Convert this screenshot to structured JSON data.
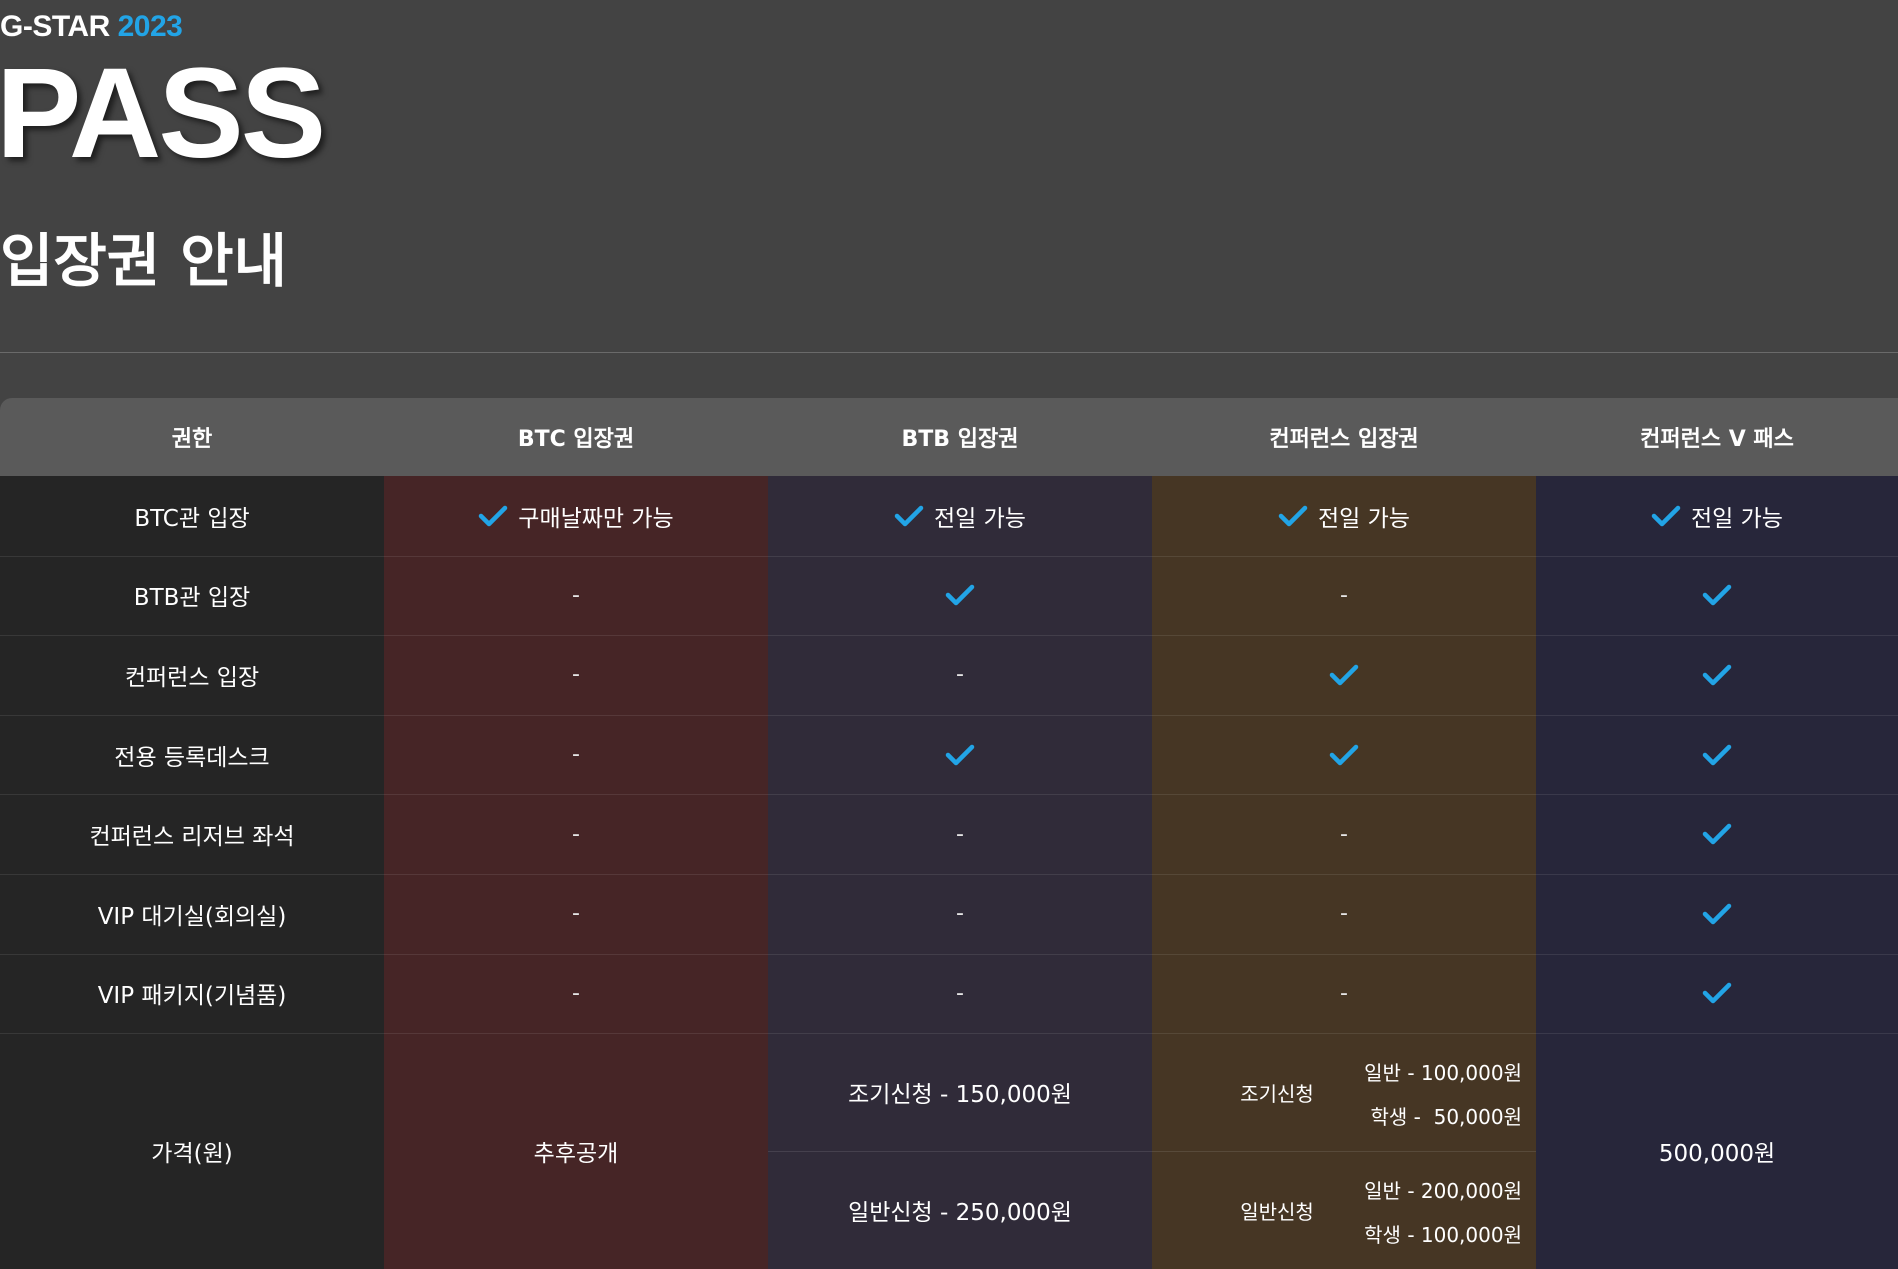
{
  "brand": {
    "name": "G-STAR",
    "year": "2023"
  },
  "hero": {
    "title": "PASS"
  },
  "section": {
    "title": "입장권 안내"
  },
  "colors": {
    "page_bg": "#434343",
    "header_bg": "#5a5a5a",
    "col_rights": "#252525",
    "col_btc": "#462526",
    "col_btb": "#302b39",
    "col_conf": "#463624",
    "col_vpass": "#27263a",
    "accent": "#22a4e6"
  },
  "table": {
    "headers": [
      "권한",
      "BTC 입장권",
      "BTB 입장권",
      "컨퍼런스 입장권",
      "컨퍼런스 V 패스"
    ],
    "rows": [
      {
        "label": "BTC관 입장",
        "cells": [
          {
            "check": true,
            "text": "구매날짜만 가능"
          },
          {
            "check": true,
            "text": "전일 가능"
          },
          {
            "check": true,
            "text": "전일 가능"
          },
          {
            "check": true,
            "text": "전일 가능"
          }
        ]
      },
      {
        "label": "BTB관 입장",
        "cells": [
          {
            "check": false,
            "text": "-"
          },
          {
            "check": true,
            "text": ""
          },
          {
            "check": false,
            "text": "-"
          },
          {
            "check": true,
            "text": ""
          }
        ]
      },
      {
        "label": "컨퍼런스 입장",
        "cells": [
          {
            "check": false,
            "text": "-"
          },
          {
            "check": false,
            "text": "-"
          },
          {
            "check": true,
            "text": ""
          },
          {
            "check": true,
            "text": ""
          }
        ]
      },
      {
        "label": "전용 등록데스크",
        "cells": [
          {
            "check": false,
            "text": "-"
          },
          {
            "check": true,
            "text": ""
          },
          {
            "check": true,
            "text": ""
          },
          {
            "check": true,
            "text": ""
          }
        ]
      },
      {
        "label": "컨퍼런스 리저브 좌석",
        "cells": [
          {
            "check": false,
            "text": "-"
          },
          {
            "check": false,
            "text": "-"
          },
          {
            "check": false,
            "text": "-"
          },
          {
            "check": true,
            "text": ""
          }
        ]
      },
      {
        "label": "VIP 대기실(회의실)",
        "cells": [
          {
            "check": false,
            "text": "-"
          },
          {
            "check": false,
            "text": "-"
          },
          {
            "check": false,
            "text": "-"
          },
          {
            "check": true,
            "text": ""
          }
        ]
      },
      {
        "label": "VIP 패키지(기념품)",
        "cells": [
          {
            "check": false,
            "text": "-"
          },
          {
            "check": false,
            "text": "-"
          },
          {
            "check": false,
            "text": "-"
          },
          {
            "check": true,
            "text": ""
          }
        ]
      }
    ],
    "price": {
      "label": "가격(원)",
      "btc": "추후공개",
      "btb": [
        "조기신청 - 150,000원",
        "일반신청 - 250,000원"
      ],
      "conf": [
        {
          "label": "조기신청",
          "lines": [
            "일반 - 100,000원",
            "학생 -  50,000원"
          ]
        },
        {
          "label": "일반신청",
          "lines": [
            "일반 - 200,000원",
            "학생 - 100,000원"
          ]
        }
      ],
      "vpass": "500,000원"
    }
  }
}
